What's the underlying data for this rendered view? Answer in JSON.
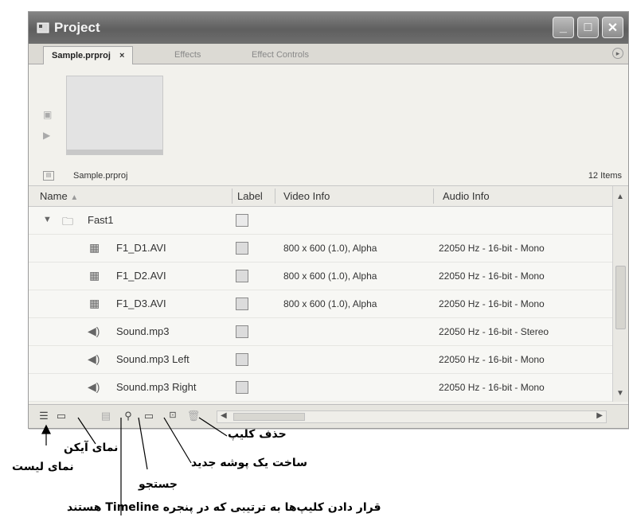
{
  "window": {
    "title": "Project",
    "tabs": [
      {
        "label": "Sample.prproj",
        "active": true,
        "close": "×"
      },
      {
        "label": "Effects",
        "active": false
      },
      {
        "label": "Effect Controls",
        "active": false
      }
    ]
  },
  "project_bar": {
    "name": "Sample.prproj",
    "count": "12 Items"
  },
  "columns": {
    "name": "Name",
    "label": "Label",
    "video": "Video Info",
    "audio": "Audio Info"
  },
  "rows": [
    {
      "name": "Fast1",
      "type": "folder",
      "video": "",
      "audio": ""
    },
    {
      "name": "F1_D1.AVI",
      "type": "video",
      "video": "800 x 600 (1.0), Alpha",
      "audio": "22050 Hz - 16-bit - Mono"
    },
    {
      "name": "F1_D2.AVI",
      "type": "video",
      "video": "800 x 600 (1.0), Alpha",
      "audio": "22050 Hz - 16-bit - Mono"
    },
    {
      "name": "F1_D3.AVI",
      "type": "video",
      "video": "800 x 600 (1.0), Alpha",
      "audio": "22050 Hz - 16-bit - Mono"
    },
    {
      "name": "Sound.mp3",
      "type": "audio",
      "video": "",
      "audio": "22050 Hz - 16-bit - Stereo"
    },
    {
      "name": "Sound.mp3 Left",
      "type": "audio",
      "video": "",
      "audio": "22050 Hz - 16-bit - Mono"
    },
    {
      "name": "Sound.mp3 Right",
      "type": "audio",
      "video": "",
      "audio": "22050 Hz - 16-bit - Mono"
    }
  ],
  "icons": [
    "list-view-icon",
    "icon-view-icon",
    "automate-to-sequence-icon",
    "find-icon",
    "new-bin-icon",
    "new-item-icon",
    "clear-icon"
  ],
  "annotations": {
    "delete_clip": "حذف کلیپ",
    "icon_view": "نمای آیکن",
    "list_view": "نمای لیست",
    "new_folder": "ساخت یک پوشه جدید",
    "search": "جستجو",
    "automate": "قرار دادن کلیپ‌ها به ترتیبی که در پنجره Timeline هستند"
  },
  "colors": {
    "titlebar": "#6e6e6e",
    "panel": "#f2f1ec",
    "list": "#f7f7f4"
  }
}
